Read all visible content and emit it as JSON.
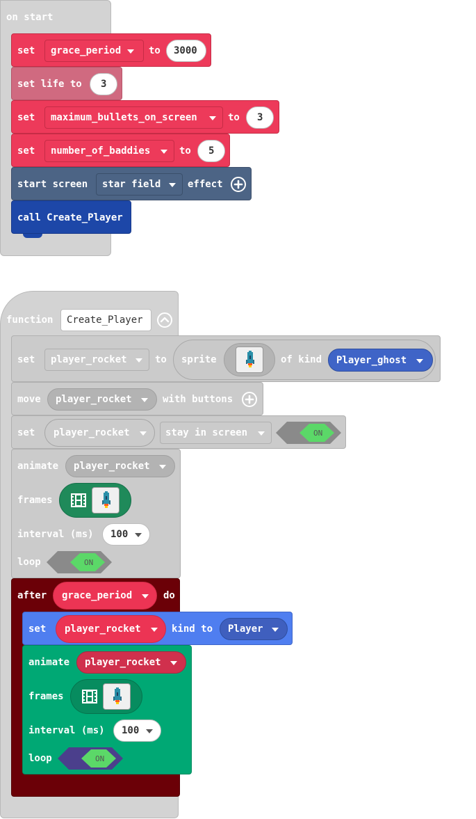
{
  "on_start": {
    "title": "on start",
    "set_grace": {
      "set": "set",
      "var": "grace_period",
      "to": "to",
      "value": "3000"
    },
    "set_life": {
      "label": "set life to",
      "value": "3"
    },
    "set_max": {
      "set": "set",
      "var": "maximum_bullets_on_screen",
      "to": "to",
      "value": "3"
    },
    "set_baddies": {
      "set": "set",
      "var": "number_of_baddies",
      "to": "to",
      "value": "5"
    },
    "screen": {
      "start": "start screen",
      "effect_value": "star field",
      "effect": "effect"
    },
    "call": {
      "label": "call Create_Player"
    }
  },
  "function": {
    "keyword": "function",
    "name": "Create_Player",
    "set_sprite": {
      "set": "set",
      "var": "player_rocket",
      "to": "to",
      "sprite": "sprite",
      "of_kind": "of kind",
      "kind": "Player_ghost"
    },
    "move": {
      "move": "move",
      "var": "player_rocket",
      "with": "with buttons"
    },
    "stay": {
      "set": "set",
      "var": "player_rocket",
      "flag": "stay in screen",
      "toggle": "ON"
    },
    "animate1": {
      "animate": "animate",
      "var": "player_rocket",
      "frames": "frames",
      "interval": "interval (ms)",
      "interval_value": "100",
      "loop": "loop",
      "loop_toggle": "ON"
    },
    "after": {
      "after": "after",
      "var": "grace_period",
      "do": "do"
    },
    "set_kind": {
      "set": "set",
      "var": "player_rocket",
      "kind_to": "kind to",
      "kind": "Player"
    },
    "animate2": {
      "animate": "animate",
      "var": "player_rocket",
      "frames": "frames",
      "interval": "interval (ms)",
      "interval_value": "100",
      "loop": "loop",
      "loop_toggle": "ON"
    }
  },
  "colors": {
    "set_red": "#ed3a5a",
    "game_slate": "#4c6485",
    "function_blue": "#1d47a8",
    "disabled_grey": "#cbcbcb",
    "after_maroon": "#6b0007",
    "sprites_blue": "#4f7ef0",
    "animation_green": "#00a874"
  },
  "icons": [
    "caret-down-icon",
    "plus-circle-icon",
    "collapse-up-icon",
    "film-icon",
    "rocket-sprite-icon",
    "toggle-on-icon"
  ]
}
